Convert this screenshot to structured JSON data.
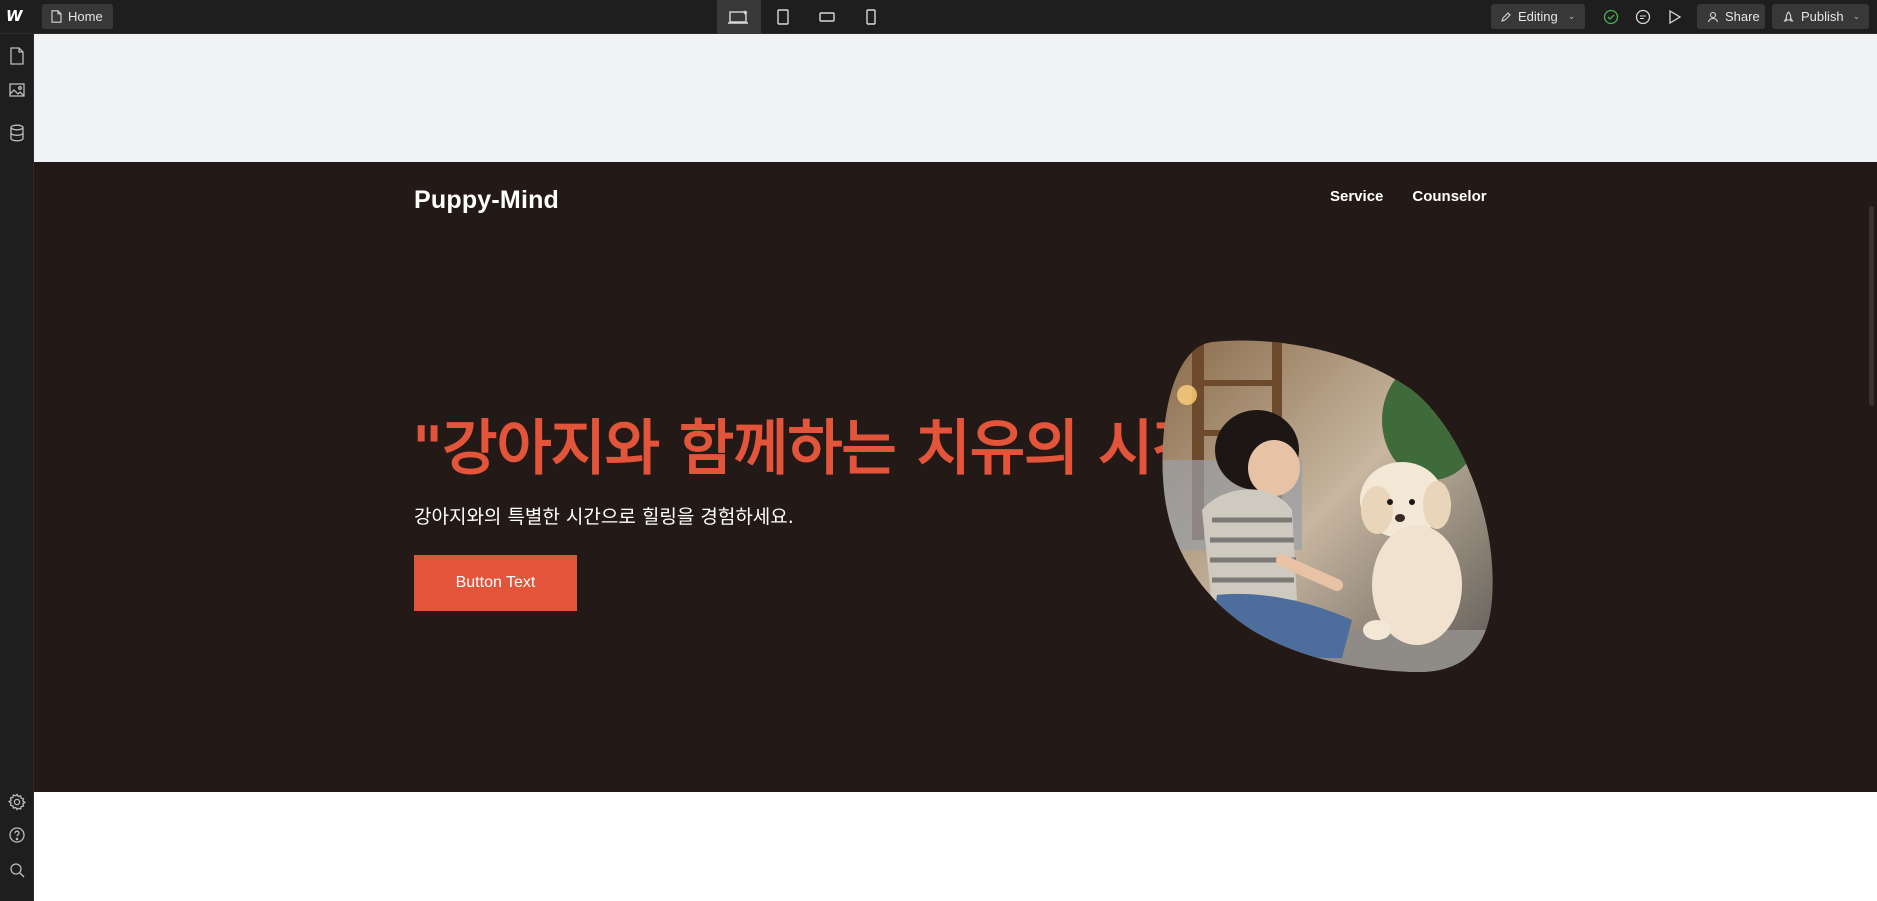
{
  "topbar": {
    "logo": "W",
    "page_name": "Home",
    "devices": [
      "desktop-icon",
      "tablet-icon",
      "mobile-landscape-icon",
      "mobile-portrait-icon"
    ],
    "mode_label": "Editing",
    "share_label": "Share",
    "publish_label": "Publish"
  },
  "rail": {
    "top_icons": [
      "pages-icon",
      "assets-icon",
      "cms-icon"
    ],
    "bottom_icons": [
      "settings-icon",
      "help-icon",
      "search-icon"
    ]
  },
  "site": {
    "brand": "Puppy-Mind",
    "nav": [
      "Service",
      "Counselor"
    ],
    "headline": "\"강아지와 함께하는 치유의 시간\"",
    "subline": "강아지와의 특별한 시간으로 힐링을 경험하세요.",
    "cta_label": "Button Text"
  },
  "colors": {
    "hero_bg": "#231a17",
    "accent": "#e2553a",
    "chrome": "#1e1e1e"
  }
}
